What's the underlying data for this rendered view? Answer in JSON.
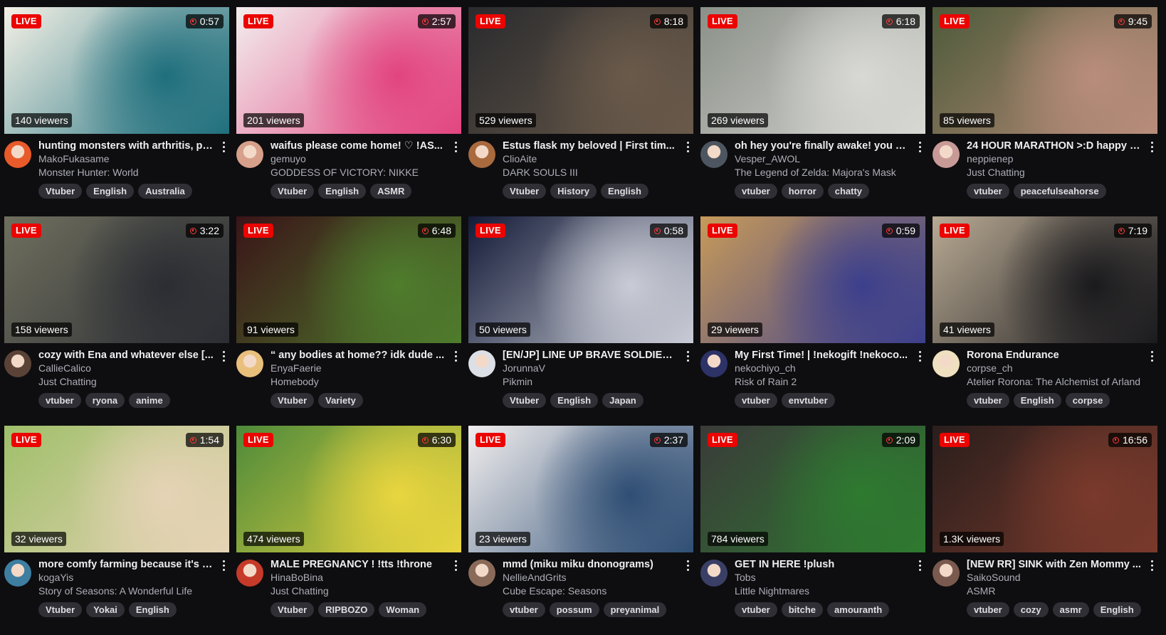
{
  "ui": {
    "live_label": "LIVE"
  },
  "streams": [
    {
      "title": "hunting monsters with arthritis, pl...",
      "channel": "MakoFukasame",
      "category": "Monster Hunter: World",
      "uptime": "0:57",
      "viewers": "140 viewers",
      "tags": [
        "Vtuber",
        "English",
        "Australia"
      ],
      "thumb_colors": [
        "#f4f1e6",
        "#1f6f7d"
      ],
      "avatar_color": "#e85a2a"
    },
    {
      "title": "waifus please come home! ♡ !AS...",
      "channel": "gemuyo",
      "category": "GODDESS OF VICTORY: NIKKE",
      "uptime": "2:57",
      "viewers": "201 viewers",
      "tags": [
        "Vtuber",
        "English",
        "ASMR"
      ],
      "thumb_colors": [
        "#f2eeee",
        "#e2447f"
      ],
      "avatar_color": "#d7a08a"
    },
    {
      "title": "Estus flask my beloved | First tim...",
      "channel": "ClioAite",
      "category": "DARK SOULS III",
      "uptime": "8:18",
      "viewers": "529 viewers",
      "tags": [
        "Vtuber",
        "History",
        "English"
      ],
      "thumb_colors": [
        "#2a2b2e",
        "#6a5a4a"
      ],
      "avatar_color": "#a96a3e"
    },
    {
      "title": "oh hey you're finally awake! you hi...",
      "channel": "Vesper_AWOL",
      "category": "The Legend of Zelda: Majora's Mask",
      "uptime": "6:18",
      "viewers": "269 viewers",
      "tags": [
        "vtuber",
        "horror",
        "chatty"
      ],
      "thumb_colors": [
        "#8a9088",
        "#d8d8d4"
      ],
      "avatar_color": "#4d5660"
    },
    {
      "title": "24 HOUR MARATHON >:D happy 1...",
      "channel": "neppienep",
      "category": "Just Chatting",
      "uptime": "9:45",
      "viewers": "85 viewers",
      "tags": [
        "vtuber",
        "peacefulseahorse"
      ],
      "thumb_colors": [
        "#4e5a3a",
        "#b98d7b"
      ],
      "avatar_color": "#c89a97"
    },
    {
      "title": "cozy with Ena and whatever else [...",
      "channel": "CallieCalico",
      "category": "Just Chatting",
      "uptime": "3:22",
      "viewers": "158 viewers",
      "tags": [
        "vtuber",
        "ryona",
        "anime"
      ],
      "thumb_colors": [
        "#6f6f5e",
        "#2b2d33"
      ],
      "avatar_color": "#5a4336"
    },
    {
      "title": "“ any bodies at home?? idk dude ...",
      "channel": "EnyaFaerie",
      "category": "Homebody",
      "uptime": "6:48",
      "viewers": "91 viewers",
      "tags": [
        "Vtuber",
        "Variety"
      ],
      "thumb_colors": [
        "#3a1418",
        "#4f7d2d"
      ],
      "avatar_color": "#e8c07c"
    },
    {
      "title": "[EN/JP] LINE UP BRAVE SOLDIERS...",
      "channel": "JorunnaV",
      "category": "Pikmin",
      "uptime": "0:58",
      "viewers": "50 viewers",
      "tags": [
        "Vtuber",
        "English",
        "Japan"
      ],
      "thumb_colors": [
        "#141b38",
        "#c9ccd6"
      ],
      "avatar_color": "#dcdfe6"
    },
    {
      "title": "My First Time! | !nekogift !nekoco...",
      "channel": "nekochiyo_ch",
      "category": "Risk of Rain 2",
      "uptime": "0:59",
      "viewers": "29 viewers",
      "tags": [
        "vtuber",
        "envtuber"
      ],
      "thumb_colors": [
        "#c79a5a",
        "#3c3f8c"
      ],
      "avatar_color": "#2d3267"
    },
    {
      "title": "Rorona Endurance",
      "channel": "corpse_ch",
      "category": "Atelier Rorona: The Alchemist of Arland",
      "uptime": "7:19",
      "viewers": "41 viewers",
      "tags": [
        "vtuber",
        "English",
        "corpse"
      ],
      "thumb_colors": [
        "#b8a993",
        "#1a1a1d"
      ],
      "avatar_color": "#efe1bf"
    },
    {
      "title": "more comfy farming because it's t...",
      "channel": "kogaYis",
      "category": "Story of Seasons: A Wonderful Life",
      "uptime": "1:54",
      "viewers": "32 viewers",
      "tags": [
        "Vtuber",
        "Yokai",
        "English"
      ],
      "thumb_colors": [
        "#9fbf6a",
        "#e6d3b6"
      ],
      "avatar_color": "#3d7ea1"
    },
    {
      "title": "MALE PREGNANCY ! !tts !throne",
      "channel": "HinaBoBina",
      "category": "Just Chatting",
      "uptime": "6:30",
      "viewers": "474 viewers",
      "tags": [
        "Vtuber",
        "RIPBOZO",
        "Woman"
      ],
      "thumb_colors": [
        "#4e8a3a",
        "#e9d53f"
      ],
      "avatar_color": "#c63a2a"
    },
    {
      "title": "mmd (miku miku dnonograms)",
      "channel": "NellieAndGrits",
      "category": "Cube Escape: Seasons",
      "uptime": "2:37",
      "viewers": "23 viewers",
      "tags": [
        "vtuber",
        "possum",
        "preyanimal"
      ],
      "thumb_colors": [
        "#f1eeee",
        "#2f4e74"
      ],
      "avatar_color": "#8a6a58"
    },
    {
      "title": "GET IN HERE !plush",
      "channel": "Tobs",
      "category": "Little Nightmares",
      "uptime": "2:09",
      "viewers": "784 viewers",
      "tags": [
        "vtuber",
        "bitche",
        "amouranth"
      ],
      "thumb_colors": [
        "#3a3b39",
        "#2e7a30"
      ],
      "avatar_color": "#3a3f66"
    },
    {
      "title": "[NEW RR] SINK with Zen Mommy ...",
      "channel": "SaikoSound",
      "category": "ASMR",
      "uptime": "16:56",
      "viewers": "1.3K viewers",
      "tags": [
        "vtuber",
        "cozy",
        "asmr",
        "English"
      ],
      "thumb_colors": [
        "#2a1e1c",
        "#7a3a2c"
      ],
      "avatar_color": "#7a5a4e"
    }
  ]
}
